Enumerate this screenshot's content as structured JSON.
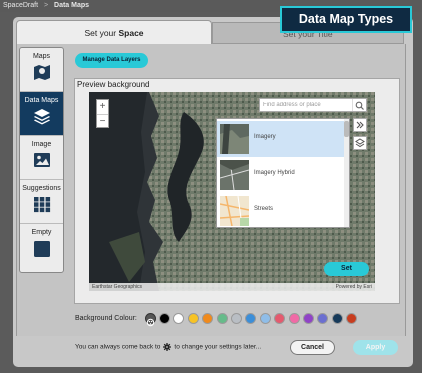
{
  "breadcrumb": {
    "root": "SpaceDraft",
    "separator": ">",
    "current": "Data Maps"
  },
  "tabs": [
    {
      "prefix": "Set your ",
      "strong": "Space"
    },
    {
      "label": "Set your Title"
    }
  ],
  "callout": "Data Map Types",
  "sidebar": {
    "items": [
      {
        "label": "Maps",
        "icon": "map-icon"
      },
      {
        "label": "Data Maps",
        "icon": "layers-icon",
        "active": true
      },
      {
        "label": "Image",
        "icon": "image-icon"
      },
      {
        "label": "Suggestions",
        "icon": "grid-icon"
      },
      {
        "label": "Empty",
        "icon": "square-icon"
      }
    ]
  },
  "manage_button": "Manage Data Layers",
  "preview_label": "Preview background",
  "map": {
    "search_placeholder": "Find address or place",
    "zoom_in": "+",
    "zoom_out": "−",
    "attribution_left": "Earthstar Geographics",
    "attribution_right": "Powered by Esri"
  },
  "layers": [
    {
      "name": "Imagery",
      "selected": true
    },
    {
      "name": "Imagery Hybrid"
    },
    {
      "name": "Streets"
    }
  ],
  "set_button": "Set",
  "background_colour": {
    "label": "Background Colour:",
    "swatches": [
      "#000000",
      "#ffffff",
      "#f7c325",
      "#f08a1c",
      "#66bb8a",
      "#b9bec4",
      "#3b8ed8",
      "#8fbde8",
      "#e45a6e",
      "#f06aa6",
      "#9043c6",
      "#6b6fd0",
      "#163a5a",
      "#c73d1f"
    ]
  },
  "footer": {
    "note_before": "You can always come back to",
    "note_after": "to change your settings later...",
    "cancel": "Cancel",
    "apply": "Apply"
  },
  "colors": {
    "accent": "#29c9d7",
    "navy": "#133b5f"
  }
}
